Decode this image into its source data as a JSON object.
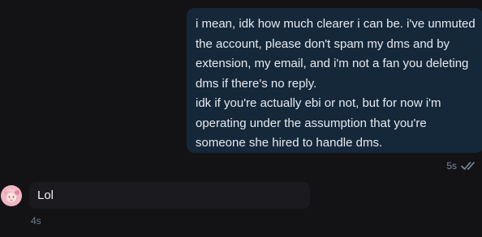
{
  "outgoing_message": {
    "lines": [
      "i mean, idk how much clearer i can be. i've unmuted",
      "the account, please don't spam my dms and by",
      "extension, my email, and i'm not a fan you deleting",
      "dms if there's no reply.",
      "idk if you're actually ebi or not, but for now i'm",
      "operating under the assumption that you're",
      "someone she hired to handle dms."
    ],
    "time": "5s",
    "status_icon": "double-check-icon"
  },
  "incoming_message": {
    "text": "Lol",
    "time": "4s",
    "avatar_icon": "user-avatar"
  },
  "colors": {
    "background": "#131316",
    "outgoing_bubble": "#15283a",
    "incoming_bubble": "#1b1b1f",
    "meta_text": "#7c8a99"
  }
}
